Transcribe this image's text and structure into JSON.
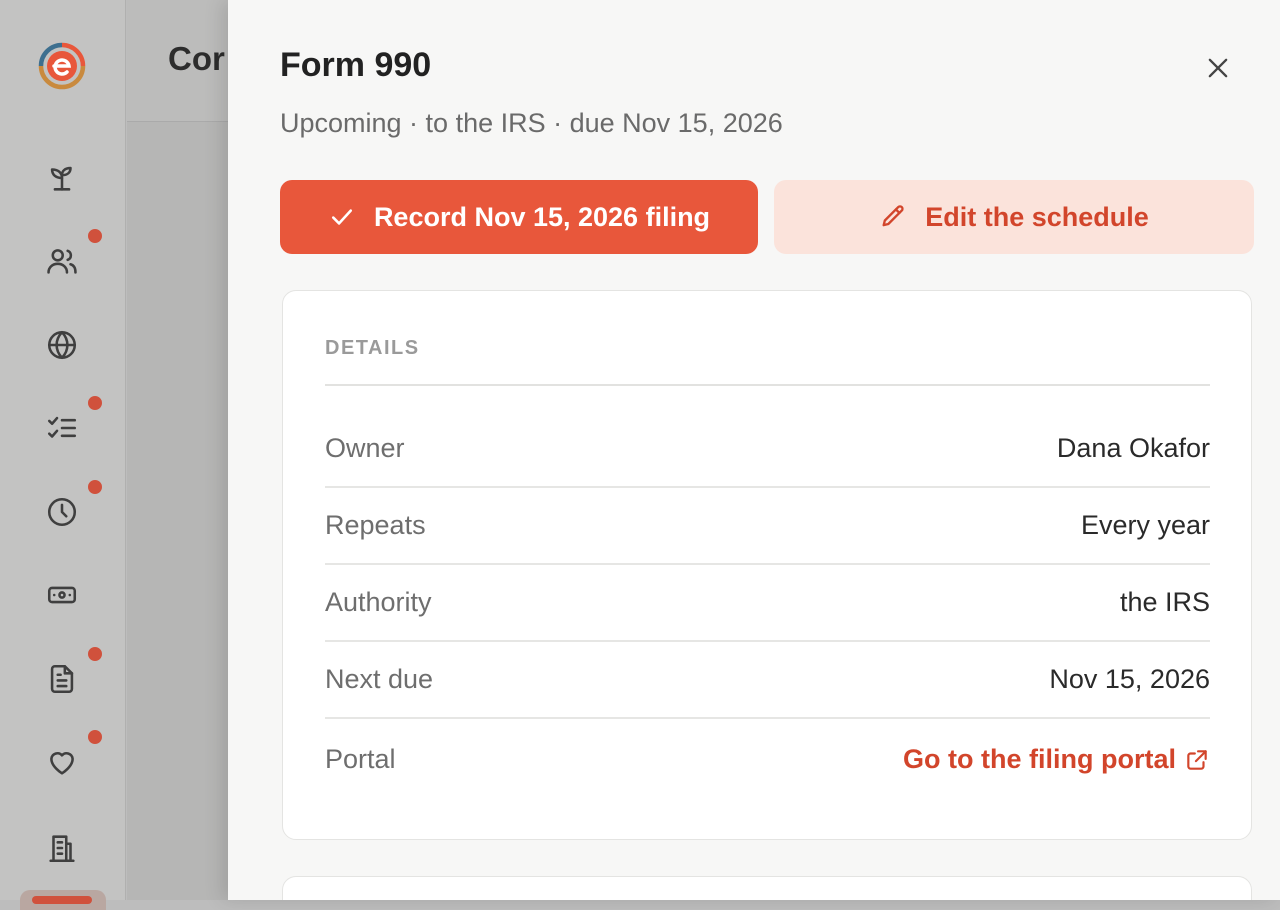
{
  "app": {
    "main_title": "Cor",
    "nav": [
      {
        "icon": "sprout-icon",
        "badge": false
      },
      {
        "icon": "users-icon",
        "badge": true
      },
      {
        "icon": "globe-icon",
        "badge": false
      },
      {
        "icon": "checklist-icon",
        "badge": true
      },
      {
        "icon": "clock-icon",
        "badge": true
      },
      {
        "icon": "banknote-icon",
        "badge": false
      },
      {
        "icon": "document-icon",
        "badge": true
      },
      {
        "icon": "heart-icon",
        "badge": true
      },
      {
        "icon": "building-icon",
        "badge": false
      }
    ]
  },
  "drawer": {
    "title": "Form 990",
    "subtitle": "Upcoming · to the IRS · due Nov 15, 2026",
    "primary_button": "Record Nov 15, 2026 filing",
    "secondary_button": "Edit the schedule",
    "details": {
      "label": "DETAILS",
      "rows": [
        {
          "label": "Owner",
          "value": "Dana Okafor"
        },
        {
          "label": "Repeats",
          "value": "Every year"
        },
        {
          "label": "Authority",
          "value": "the IRS"
        },
        {
          "label": "Next due",
          "value": "Nov 15, 2026"
        }
      ],
      "portal": {
        "label": "Portal",
        "link": "Go to the filing portal"
      }
    }
  },
  "colors": {
    "accent": "#e8573b",
    "accent_text": "#d2452b",
    "accent_soft": "#fbe3db",
    "badge": "#d0513c"
  }
}
